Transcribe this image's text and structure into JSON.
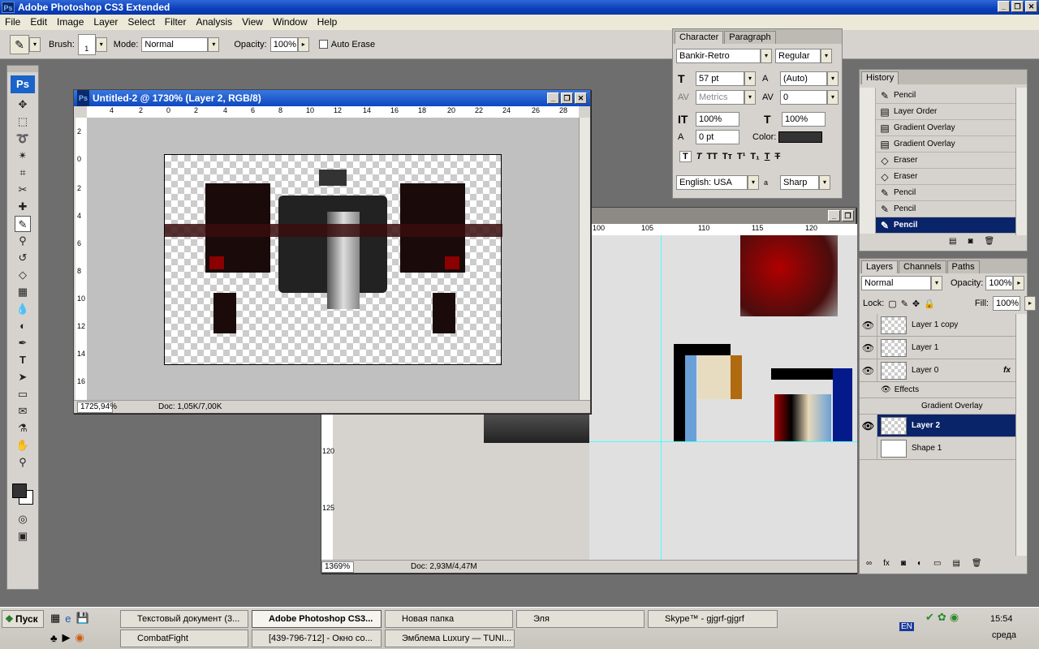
{
  "app": {
    "title": "Adobe Photoshop CS3 Extended"
  },
  "menu": [
    "File",
    "Edit",
    "Image",
    "Layer",
    "Select",
    "Filter",
    "Analysis",
    "View",
    "Window",
    "Help"
  ],
  "options": {
    "brush_label": "Brush:",
    "brush_size": "1",
    "mode_label": "Mode:",
    "mode_value": "Normal",
    "opacity_label": "Opacity:",
    "opacity_value": "100%",
    "auto_erase": "Auto Erase"
  },
  "doc1": {
    "title": "Untitled-2 @ 1730% (Layer 2, RGB/8)",
    "zoom": "1725,94%",
    "doc_info": "Doc: 1,05K/7,00K",
    "ruler_h": [
      "4",
      "2",
      "0",
      "2",
      "4",
      "6",
      "8",
      "10",
      "12",
      "14",
      "16",
      "18",
      "20",
      "22",
      "24",
      "26",
      "28"
    ],
    "ruler_v": [
      "2",
      "0",
      "2",
      "4",
      "6",
      "8",
      "10",
      "12",
      "14",
      "16"
    ]
  },
  "doc2": {
    "zoom": "1369%",
    "doc_info": "Doc: 2,93M/4,47M",
    "ruler_h": [
      "100",
      "105",
      "110",
      "115",
      "120"
    ],
    "ruler_v": [
      "120",
      "125"
    ]
  },
  "character": {
    "tabs": [
      "Character",
      "Paragraph"
    ],
    "font": "Bankir-Retro",
    "style": "Regular",
    "size": "57 pt",
    "leading": "(Auto)",
    "kerning": "Metrics",
    "tracking": "0",
    "vscale": "100%",
    "hscale": "100%",
    "baseline": "0 pt",
    "color_label": "Color:",
    "color": "#333333",
    "language": "English: USA",
    "aa_label": "a",
    "aa": "Sharp"
  },
  "history": {
    "tab": "History",
    "items": [
      "Pencil",
      "Layer Order",
      "Gradient Overlay",
      "Gradient Overlay",
      "Eraser",
      "Eraser",
      "Pencil",
      "Pencil",
      "Pencil"
    ],
    "selected": 8
  },
  "layers": {
    "tabs": [
      "Layers",
      "Channels",
      "Paths"
    ],
    "blend": "Normal",
    "opacity_label": "Opacity:",
    "opacity": "100%",
    "lock_label": "Lock:",
    "fill_label": "Fill:",
    "fill": "100%",
    "effects": "Effects",
    "gradient_overlay": "Gradient Overlay",
    "items": [
      "Layer 1 copy",
      "Layer 1",
      "Layer 0",
      "Layer 2",
      "Shape 1"
    ],
    "selected": "Layer 2"
  },
  "taskbar": {
    "start": "Пуск",
    "row1": [
      "Текстовый документ (3...",
      "Adobe Photoshop CS3...",
      "Новая папка",
      "Эля",
      "Skype™ - gjgrf-gjgrf"
    ],
    "row2": [
      "CombatFight",
      "[439-796-712] - Окно со...",
      "Эмблема Luxury — TUNI..."
    ],
    "lang": "EN",
    "time": "15:54",
    "day": "среда"
  }
}
